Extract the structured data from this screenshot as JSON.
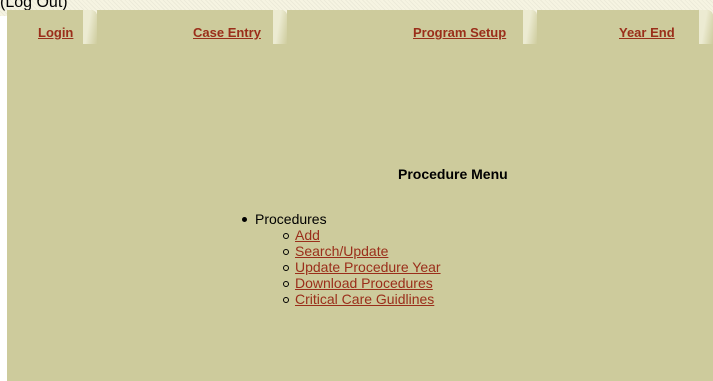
{
  "header": {
    "logout_text": "(Log Out)"
  },
  "nav": {
    "tabs": [
      {
        "label": "Login"
      },
      {
        "label": "Case Entry"
      },
      {
        "label": "Program Setup"
      },
      {
        "label": "Year End"
      }
    ]
  },
  "main": {
    "title": "Procedure Menu",
    "section_label": "Procedures",
    "links": [
      {
        "label": "Add"
      },
      {
        "label": "Search/Update"
      },
      {
        "label": "Update Procedure Year"
      },
      {
        "label": "Download Procedures"
      },
      {
        "label": "Critical Care Guidlines"
      }
    ]
  },
  "colors": {
    "background": "#cdcb9c",
    "link": "#9a2e1a"
  }
}
